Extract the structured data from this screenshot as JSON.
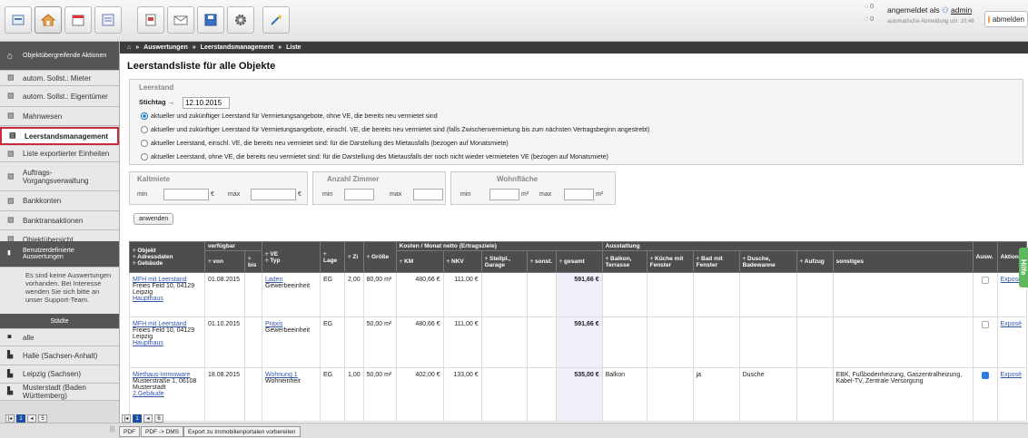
{
  "toolbar": {
    "icons": [
      "dashboard-icon",
      "home-icon",
      "calendar-icon",
      "list-icon",
      "document-icon",
      "mail-icon",
      "save-icon",
      "gear-icon",
      "wand-icon"
    ]
  },
  "user": {
    "prefix": "angemeldet als",
    "name": "admin",
    "auto_logout": "automatische Abmeldung um: 10:46",
    "logout": "abmelden",
    "badge1": "0",
    "badge2": "0"
  },
  "breadcrumb": [
    "Auswertungen",
    "Leerstandsmanagement",
    "Liste"
  ],
  "sidebar": {
    "header": "Objektübergreifende Aktionen",
    "items": [
      "autom. Sollst.: Mieter",
      "autom. Sollst.: Eigentümer",
      "Mahnwesen",
      "Leerstandsmanagement",
      "Liste exportierter Einheiten",
      "Auftrags-Vorgangsverwaltung",
      "Bankkonten",
      "Banktransaktionen",
      "Objektübersicht"
    ],
    "custom_header": "Benutzerdefinierte Auswertungen",
    "custom_note": "Es sind keine Auswertungen vorhanden. Bei Interesse wenden Sie sich bitte an unser Support-Team.",
    "cities_header": "Städte",
    "cities": [
      "alle",
      "Halle (Sachsen-Anhalt)",
      "Leipzig (Sachsen)",
      "Musterstadt (Baden Württemberg)"
    ],
    "pager": [
      "1",
      "5"
    ]
  },
  "page": {
    "title": "Leerstandsliste für alle Objekte",
    "leerstand_legend": "Leerstand",
    "stichtag_label": "Stichtag →",
    "stichtag_value": "12.10.2015",
    "options": [
      "aktueller und zukünftiger Leerstand für Vermietungsangebote, ohne VE, die bereits neu vermietet sind",
      "aktueller und zukünftiger Leerstand für Vermietungsangebote, einschl. VE, die bereits neu vermietet sind (falls Zwischenvermietung bis zum nächsten Vertragsbeginn angestrebt)",
      "aktueller Leerstand, einschl. VE, die bereits neu vermietet sind: für die Darstellung des Mietausfalls (bezogen auf Monatsmiete)",
      "aktueller Leerstand, ohne VE, die bereits neu vermietet sind: für die Darstellung des Mietausfalls der noch nicht wieder vermieteten VE (bezogen auf Monatsmiete)"
    ],
    "selected_option": 0,
    "kaltmiete": {
      "legend": "Kaltmiete",
      "min": "min",
      "max": "max",
      "unit": "€"
    },
    "zimmer": {
      "legend": "Anzahl Zimmer",
      "min": "min",
      "max": "max"
    },
    "wohnflaeche": {
      "legend": "Wohnfläche",
      "min": "min",
      "max": "max",
      "unit": "m²"
    },
    "apply": "anwenden"
  },
  "table": {
    "group_headers": {
      "verfuegbar": "verfügbar",
      "kosten": "Kosten / Monat netto (Ertragsziele)",
      "ausstattung": "Ausstattung"
    },
    "h_objekt": "÷ Objekt",
    "h_adresse": "÷ Adressdaten",
    "h_gebaeude": "÷ Gebäude",
    "h_von": "÷ von",
    "h_bis": "÷ bis",
    "h_ve": "÷ VE",
    "h_typ": "÷ Typ",
    "h_lage": "÷ Lage",
    "h_zi": "÷ Zi",
    "h_groesse": "÷ Größe",
    "h_km": "÷ KM",
    "h_nkv": "÷ NKV",
    "h_stellpl": "÷ Stellpl., Garage",
    "h_sonst": "÷ sonst.",
    "h_gesamt": "÷ gesamt",
    "h_balkon": "÷ Balkon, Terrasse",
    "h_kueche": "÷ Küche mit Fenster",
    "h_bad": "÷ Bad mit Fenster",
    "h_dusche": "÷ Dusche, Badewanne",
    "h_aufzug": "÷ Aufzug",
    "h_sonstiges": "sonstiges",
    "h_ausw": "Ausw.",
    "h_aktion": "Aktion",
    "rows": [
      {
        "objekt": "MFH mit Leerstand",
        "addr1": "Freies Feld 10, 04129",
        "addr2": "Leipzig",
        "gebaeude": "Haupthaus",
        "von": "01.08.2015",
        "bis": "",
        "ve": "Laden",
        "typ": "Gewerbeeinheit",
        "lage": "EG",
        "zi": "2,00",
        "groesse": "80,00 m²",
        "km": "480,66 €",
        "nkv": "111,00 €",
        "stellpl": "",
        "sonst": "",
        "gesamt": "591,66 €",
        "balkon": "",
        "kueche": "",
        "bad": "",
        "dusche": "",
        "aufzug": "",
        "sonstiges": "",
        "checked": false,
        "aktion": "Exposé"
      },
      {
        "objekt": "MFH mit Leerstand",
        "addr1": "Freies Feld 10, 04129",
        "addr2": "Leipzig",
        "gebaeude": "Haupthaus",
        "von": "01.10.2015",
        "bis": "",
        "ve": "Praxis",
        "typ": "Gewerbeeinheit",
        "lage": "EG",
        "zi": "",
        "groesse": "50,00 m²",
        "km": "480,66 €",
        "nkv": "111,00 €",
        "stellpl": "",
        "sonst": "",
        "gesamt": "591,66 €",
        "balkon": "",
        "kueche": "",
        "bad": "",
        "dusche": "",
        "aufzug": "",
        "sonstiges": "",
        "checked": false,
        "aktion": "Exposé"
      },
      {
        "objekt": "Miethaus-Immoware",
        "addr1": "Musterstraße 1, 06108",
        "addr2": "Musterstadt",
        "gebaeude": "2.Gebäude",
        "von": "18.08.2015",
        "bis": "",
        "ve": "Wohnung 1",
        "typ": "Wohneinheit",
        "lage": "EG",
        "zi": "1,00",
        "groesse": "50,00 m²",
        "km": "402,00 €",
        "nkv": "133,00 €",
        "stellpl": "",
        "sonst": "",
        "gesamt": "535,00 €",
        "balkon": "Balkon",
        "kueche": "",
        "bad": "ja",
        "dusche": "Dusche",
        "aufzug": "",
        "sonstiges": "EBK, Fußbodenheizung, Gaszentralheizung, Kabel-TV, Zentrale Versorgung",
        "checked": true,
        "aktion": "Exposé"
      }
    ],
    "pager": [
      "1",
      "6"
    ]
  },
  "bottom": {
    "buttons": [
      "PDF",
      "PDF -> DMS",
      "Export zu Immobilienportalen vorbereiten"
    ]
  },
  "hilfe": "Hilfe",
  "colors": {
    "accent": "#cc2a3a",
    "header_dark": "#3b3b3b",
    "link": "#3355aa",
    "check": "#2b7de0"
  }
}
